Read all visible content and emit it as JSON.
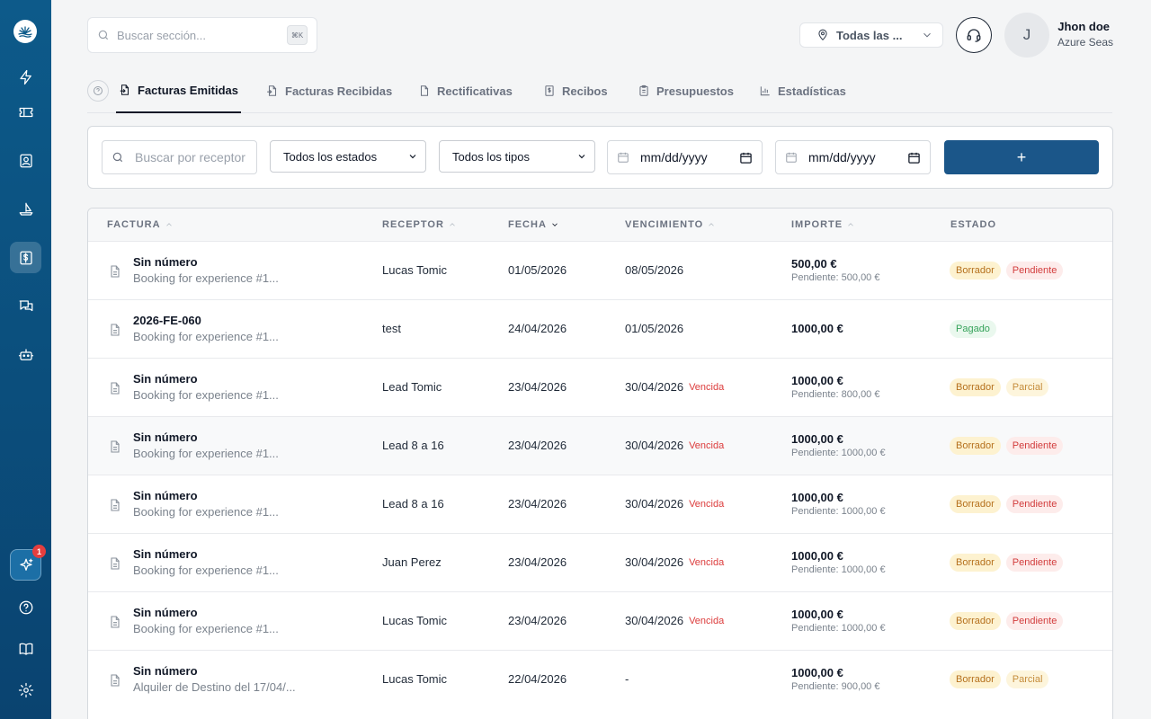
{
  "sidebar": {
    "items": [
      {
        "name": "bolt-icon"
      },
      {
        "name": "ticket-icon"
      },
      {
        "name": "contacts-icon"
      },
      {
        "name": "boat-icon"
      },
      {
        "name": "invoice-icon",
        "active": true
      },
      {
        "name": "chat-icon"
      },
      {
        "name": "bot-icon"
      }
    ],
    "ai_badge": "1"
  },
  "header": {
    "search_placeholder": "Buscar sección...",
    "search_shortcut": "⌘K",
    "location": "Todas las ...",
    "user_initial": "J",
    "user_name": "Jhon doe",
    "user_org": "Azure Seas"
  },
  "tabs": [
    {
      "label": "Facturas Emitidas",
      "active": true
    },
    {
      "label": "Facturas Recibidas"
    },
    {
      "label": "Rectificativas"
    },
    {
      "label": "Recibos"
    },
    {
      "label": "Presupuestos"
    },
    {
      "label": "Estadísticas"
    }
  ],
  "filters": {
    "search_placeholder": "Buscar por receptor",
    "status_select": "Todos los estados",
    "type_select": "Todos los tipos",
    "date_from": "mm/dd/yyyy",
    "date_to": "mm/dd/yyyy",
    "add_label": "+"
  },
  "table": {
    "columns": [
      "FACTURA",
      "RECEPTOR",
      "FECHA",
      "VENCIMIENTO",
      "IMPORTE",
      "ESTADO"
    ],
    "overdue_label": "Vencida",
    "rows": [
      {
        "number": "Sin número",
        "desc": "Booking for experience #1...",
        "receptor": "Lucas Tomic",
        "fecha": "01/05/2026",
        "vencimiento": "08/05/2026",
        "vencida": false,
        "importe": "500,00 €",
        "pendiente": "Pendiente: 500,00 €",
        "estados": [
          {
            "label": "Borrador",
            "type": "borrador"
          },
          {
            "label": "Pendiente",
            "type": "pendiente"
          }
        ]
      },
      {
        "number": "2026-FE-060",
        "desc": "Booking for experience #1...",
        "receptor": "test",
        "fecha": "24/04/2026",
        "vencimiento": "01/05/2026",
        "vencida": false,
        "importe": "1000,00 €",
        "pendiente": "",
        "estados": [
          {
            "label": "Pagado",
            "type": "pagado"
          }
        ]
      },
      {
        "number": "Sin número",
        "desc": "Booking for experience #1...",
        "receptor": "Lead Tomic",
        "fecha": "23/04/2026",
        "vencimiento": "30/04/2026",
        "vencida": true,
        "importe": "1000,00 €",
        "pendiente": "Pendiente: 800,00 €",
        "estados": [
          {
            "label": "Borrador",
            "type": "borrador"
          },
          {
            "label": "Parcial",
            "type": "parcial"
          }
        ]
      },
      {
        "number": "Sin número",
        "desc": "Booking for experience #1...",
        "receptor": "Lead 8 a 16",
        "fecha": "23/04/2026",
        "vencimiento": "30/04/2026",
        "vencida": true,
        "importe": "1000,00 €",
        "pendiente": "Pendiente: 1000,00 €",
        "estados": [
          {
            "label": "Borrador",
            "type": "borrador"
          },
          {
            "label": "Pendiente",
            "type": "pendiente"
          }
        ],
        "highlight": true
      },
      {
        "number": "Sin número",
        "desc": "Booking for experience #1...",
        "receptor": "Lead 8 a 16",
        "fecha": "23/04/2026",
        "vencimiento": "30/04/2026",
        "vencida": true,
        "importe": "1000,00 €",
        "pendiente": "Pendiente: 1000,00 €",
        "estados": [
          {
            "label": "Borrador",
            "type": "borrador"
          },
          {
            "label": "Pendiente",
            "type": "pendiente"
          }
        ]
      },
      {
        "number": "Sin número",
        "desc": "Booking for experience #1...",
        "receptor": "Juan Perez",
        "fecha": "23/04/2026",
        "vencimiento": "30/04/2026",
        "vencida": true,
        "importe": "1000,00 €",
        "pendiente": "Pendiente: 1000,00 €",
        "estados": [
          {
            "label": "Borrador",
            "type": "borrador"
          },
          {
            "label": "Pendiente",
            "type": "pendiente"
          }
        ]
      },
      {
        "number": "Sin número",
        "desc": "Booking for experience #1...",
        "receptor": "Lucas Tomic",
        "fecha": "23/04/2026",
        "vencimiento": "30/04/2026",
        "vencida": true,
        "importe": "1000,00 €",
        "pendiente": "Pendiente: 1000,00 €",
        "estados": [
          {
            "label": "Borrador",
            "type": "borrador"
          },
          {
            "label": "Pendiente",
            "type": "pendiente"
          }
        ]
      },
      {
        "number": "Sin número",
        "desc": "Alquiler de Destino del 17/04/...",
        "receptor": "Lucas Tomic",
        "fecha": "22/04/2026",
        "vencimiento": "-",
        "vencida": false,
        "importe": "1000,00 €",
        "pendiente": "Pendiente: 900,00 €",
        "estados": [
          {
            "label": "Borrador",
            "type": "borrador"
          },
          {
            "label": "Parcial",
            "type": "parcial"
          }
        ]
      }
    ]
  }
}
